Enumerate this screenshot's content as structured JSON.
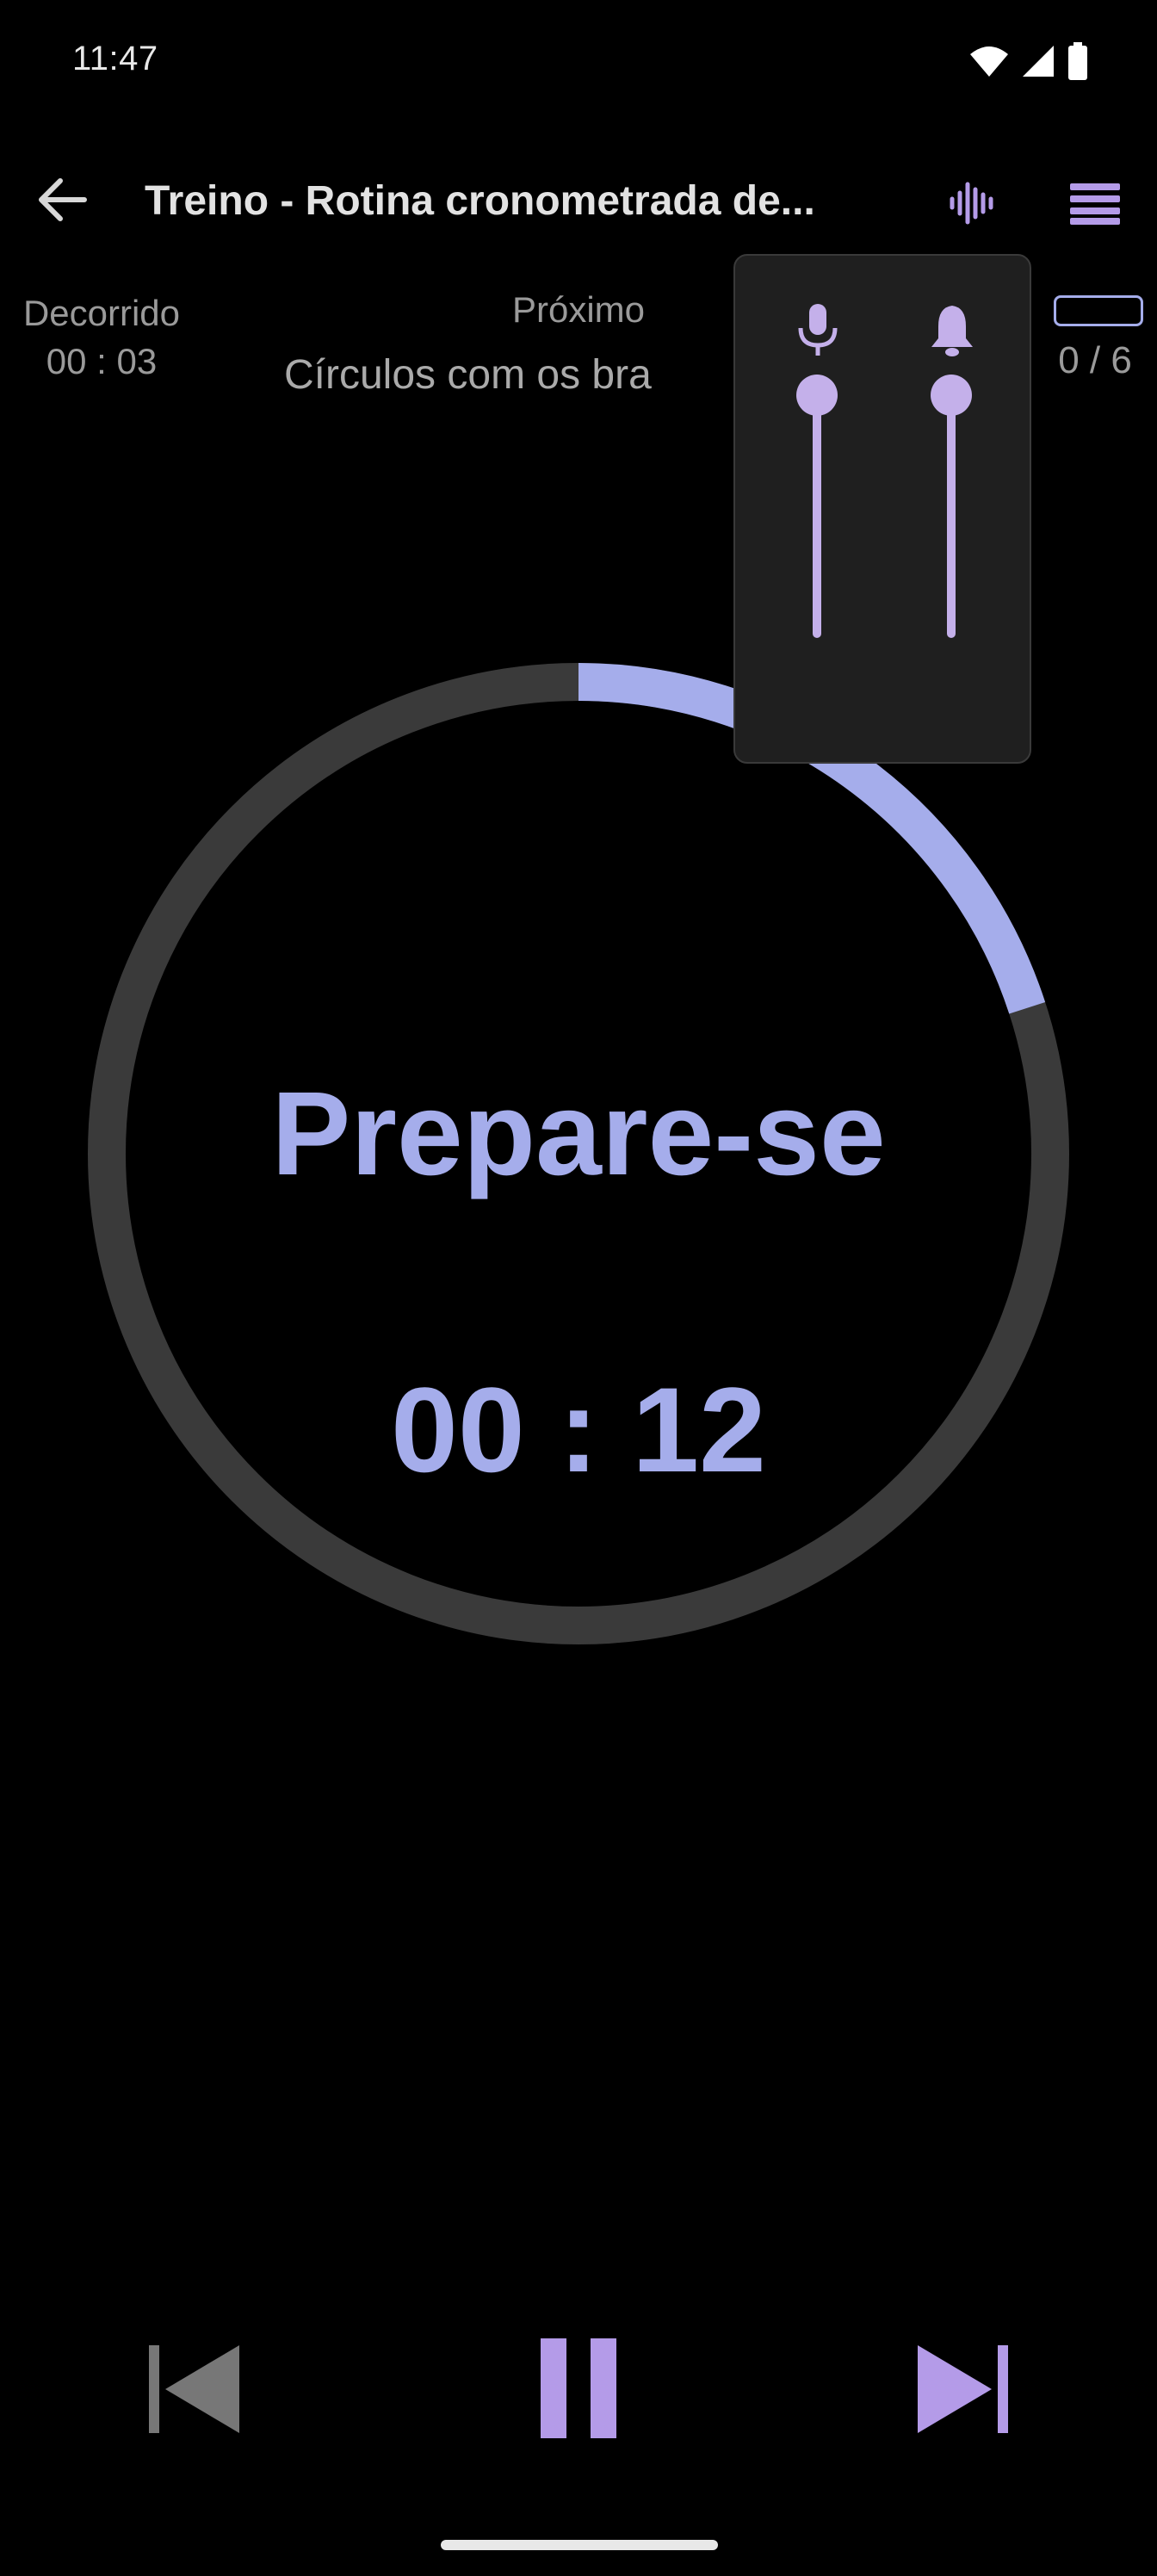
{
  "status_bar": {
    "time": "11:47",
    "icons": [
      "wifi-icon",
      "signal-icon",
      "battery-icon"
    ]
  },
  "app_bar": {
    "back_icon": "arrow-back-icon",
    "title": "Treino - Rotina cronometrada de...",
    "voice_icon": "voice-waveform-icon",
    "list_icon": "list-menu-icon"
  },
  "info": {
    "elapsed_label": "Decorrido",
    "elapsed_value": "00 : 03",
    "next_label": "Próximo",
    "next_exercise": "Círculos com os bra",
    "progress_count": "0 / 6",
    "progress_fraction": 0
  },
  "timer": {
    "phase": "Prepare-se",
    "time": "00 : 12",
    "ring_progress": 0.2
  },
  "volume_panel": {
    "voice_icon": "microphone-icon",
    "voice_level": 1.0,
    "sound_icon": "bell-icon",
    "sound_level": 1.0
  },
  "controls": {
    "previous_icon": "skip-previous-icon",
    "pause_icon": "pause-icon",
    "next_icon": "skip-next-icon"
  },
  "colors": {
    "accent": "#a5adeb",
    "accent_purple": "#c4b0ea",
    "ring_track": "#3a3a3a",
    "background": "#000000"
  }
}
